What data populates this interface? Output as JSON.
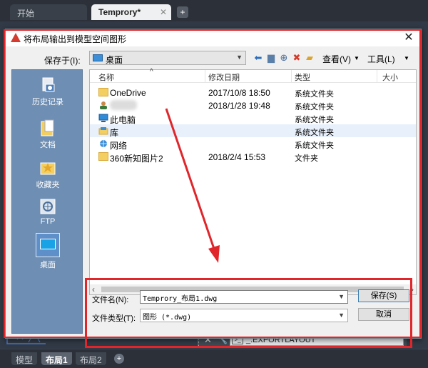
{
  "app": {
    "tabs": [
      {
        "label": "开始"
      },
      {
        "label": "Temprory*"
      }
    ],
    "new_tab": "+",
    "layout_tabs": [
      {
        "label": "模型"
      },
      {
        "label": "布局1"
      },
      {
        "label": "布局2"
      }
    ],
    "layout_new": "+",
    "command_line": {
      "text": "_.EXPORTLAYOUT",
      "prompt_icon": "command-prompt-icon"
    }
  },
  "dialog": {
    "title": "将布局输出到模型空间图形",
    "save_in_label": "保存于(I):",
    "save_in_value": "桌面",
    "toolbar": {
      "view_label": "查看(V)",
      "tools_label": "工具(L)"
    },
    "places": [
      {
        "label": "历史记录",
        "icon": "history-icon"
      },
      {
        "label": "文档",
        "icon": "documents-icon"
      },
      {
        "label": "收藏夹",
        "icon": "favorites-icon"
      },
      {
        "label": "FTP",
        "icon": "ftp-icon"
      },
      {
        "label": "桌面",
        "icon": "desktop-icon"
      }
    ],
    "columns": {
      "name": "名称",
      "date": "修改日期",
      "type": "类型",
      "size": "大小"
    },
    "files": [
      {
        "name": "OneDrive",
        "date": "2017/10/8 18:50",
        "type": "系统文件夹",
        "icon": "folder-icon"
      },
      {
        "name": "",
        "date": "2018/1/28 19:48",
        "type": "系统文件夹",
        "icon": "user-icon"
      },
      {
        "name": "此电脑",
        "date": "",
        "type": "系统文件夹",
        "icon": "computer-icon"
      },
      {
        "name": "库",
        "date": "",
        "type": "系统文件夹",
        "icon": "library-icon"
      },
      {
        "name": "网络",
        "date": "",
        "type": "系统文件夹",
        "icon": "network-icon"
      },
      {
        "name": "360新知图片2",
        "date": "2018/2/4 15:53",
        "type": "文件夹",
        "icon": "folder-icon"
      }
    ],
    "filename_label": "文件名(N):",
    "filename_value": "Temprory_布局1.dwg",
    "filetype_label": "文件类型(T):",
    "filetype_value": "图形 (*.dwg)",
    "save_button": "保存(S)",
    "cancel_button": "取消"
  },
  "annotation_color": "#e0262b"
}
